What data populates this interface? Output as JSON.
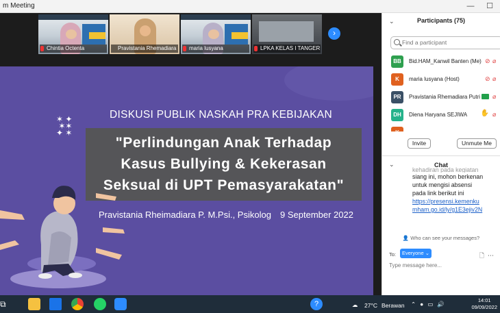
{
  "window": {
    "title": "m Meeting"
  },
  "thumbnails": [
    {
      "name": "Chintia Octenta"
    },
    {
      "name": "Pravistania Rhemadiara P..."
    },
    {
      "name": "maria lusyana"
    },
    {
      "name": "LPKA KELAS I TANGER..."
    }
  ],
  "slide": {
    "subtitle": "DISKUSI PUBLIK NASKAH PRA KEBIJAKAN",
    "quote_line1": "\"Perlindungan Anak Terhadap",
    "quote_line2": "Kasus Bullying & Kekerasan",
    "quote_line3": "Seksual di UPT Pemasyarakatan\"",
    "author": "Pravistania Rheimadiara P. M.Psi., Psikolog",
    "date": "9 September 2022"
  },
  "participants": {
    "header": "Participants (75)",
    "search_placeholder": "Find a participant",
    "items": [
      {
        "initials": "BB",
        "name": "Bid.HAM_Kanwil Banten (Me)",
        "color": "#2ea04f"
      },
      {
        "initials": "K",
        "name": "maria lusyana (Host)",
        "color": "#e0611f"
      },
      {
        "initials": "PR",
        "name": "Pravistania Rhemadiara Putri",
        "color": "#3a5066"
      },
      {
        "initials": "DH",
        "name": "Diena Haryana SEJIWA",
        "color": "#26b28b"
      },
      {
        "initials": "K",
        "name": "",
        "color": "#e0611f"
      }
    ],
    "invite_label": "Invite",
    "unmute_label": "Unmute Me"
  },
  "chat": {
    "header": "Chat",
    "message_partial": "kehadiran pada kegiatan",
    "message_l1": "siang ini, mohon berkenan",
    "message_l2": "untuk mengisi absensi",
    "message_l3": "pada link berikut ini",
    "link_l1": "https://presensi.kemenku",
    "link_l2": "mham.go.id/ly/g1E3ejiv2N",
    "who_can_see": "Who can see your messages?",
    "to_label": "To:",
    "to_value": "Everyone",
    "input_placeholder": "Type message here..."
  },
  "taskbar": {
    "weather": "27°C",
    "weather_desc": "Berawan",
    "time": "14:01",
    "date": "09/09/2022"
  },
  "colors": {
    "accent": "#2d8cff",
    "slide_bg": "#5b4ea1",
    "taskbar": "#1f2d3a"
  }
}
